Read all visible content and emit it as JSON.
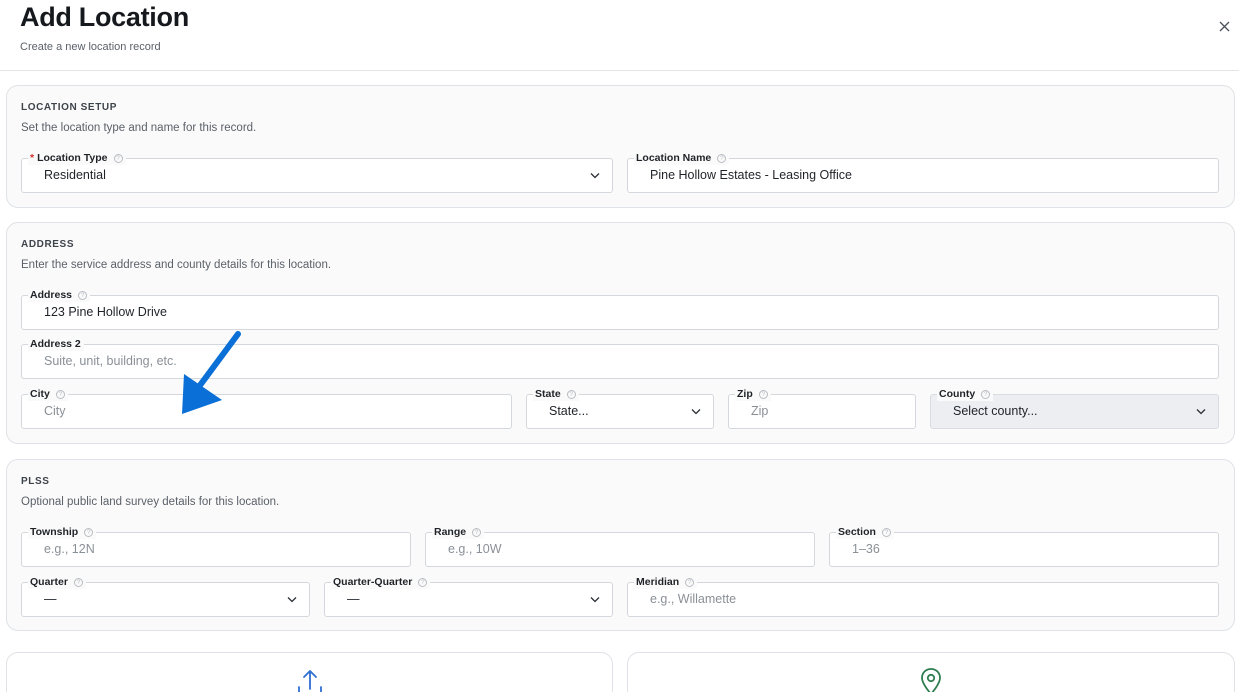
{
  "header": {
    "title": "Add Location",
    "subtitle": "Create a new location record",
    "close_icon": "close-icon"
  },
  "location_setup": {
    "title": "LOCATION SETUP",
    "description": "Set the location type and name for this record.",
    "location_type": {
      "label": "Location Type",
      "required": true,
      "value": "Residential"
    },
    "location_name": {
      "label": "Location Name",
      "value": "Pine Hollow Estates - Leasing Office"
    }
  },
  "address": {
    "title": "ADDRESS",
    "description": "Enter the service address and county details for this location.",
    "address1": {
      "label": "Address",
      "value": "123 Pine Hollow Drive"
    },
    "address2": {
      "label": "Address 2",
      "placeholder": "Suite, unit, building, etc."
    },
    "city": {
      "label": "City",
      "placeholder": "City"
    },
    "state": {
      "label": "State",
      "placeholder": "State..."
    },
    "zip": {
      "label": "Zip",
      "placeholder": "Zip"
    },
    "county": {
      "label": "County",
      "placeholder": "Select county..."
    }
  },
  "plss": {
    "title": "PLSS",
    "description": "Optional public land survey details for this location.",
    "township": {
      "label": "Township",
      "placeholder": "e.g., 12N"
    },
    "range": {
      "label": "Range",
      "placeholder": "e.g., 10W"
    },
    "section": {
      "label": "Section",
      "placeholder": "1–36"
    },
    "quarter": {
      "label": "Quarter",
      "value": "—"
    },
    "quarter_quarter": {
      "label": "Quarter-Quarter",
      "value": "—"
    },
    "meridian": {
      "label": "Meridian",
      "placeholder": "e.g., Willamette"
    }
  },
  "cards": {
    "upload_icon": "upload-icon",
    "map_pin_icon": "map-pin-icon"
  },
  "colors": {
    "annotation_arrow": "#0a6fd6",
    "required_asterisk": "#d0312d",
    "upload_icon": "#2f6fd1",
    "map_pin_icon": "#2e7d4f"
  }
}
